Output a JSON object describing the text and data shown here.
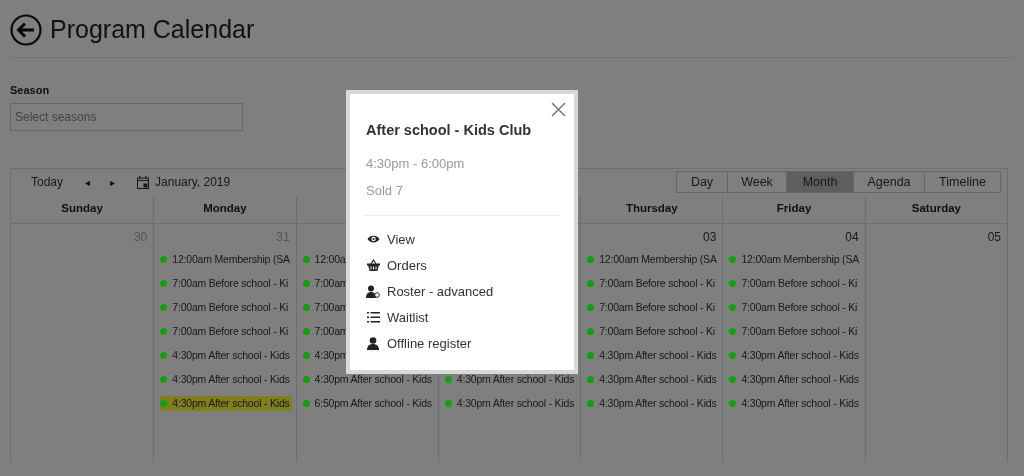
{
  "page": {
    "title": "Program Calendar"
  },
  "season": {
    "label": "Season",
    "placeholder": "Select seasons"
  },
  "toolbar": {
    "today": "Today",
    "prev": "◂",
    "next": "▸",
    "month_label": "January, 2019"
  },
  "views": [
    {
      "label": "Day",
      "selected": false
    },
    {
      "label": "Week",
      "selected": false
    },
    {
      "label": "Month",
      "selected": true
    },
    {
      "label": "Agenda",
      "selected": false
    },
    {
      "label": "Timeline",
      "selected": false
    }
  ],
  "days": [
    {
      "name": "Sunday",
      "date": "30",
      "other_month": true
    },
    {
      "name": "Monday",
      "date": "31",
      "other_month": true,
      "events": [
        {
          "text": "12:00am Membership (SA",
          "color": "#139e13",
          "highlighted": false
        },
        {
          "text": "7:00am Before school - Ki",
          "color": "#139e13",
          "highlighted": false
        },
        {
          "text": "7:00am Before school - Ki",
          "color": "#139e13",
          "highlighted": false
        },
        {
          "text": "7:00am Before school - Ki",
          "color": "#139e13",
          "highlighted": false
        },
        {
          "text": "4:30pm After school - Kids",
          "color": "#139e13",
          "highlighted": false
        },
        {
          "text": "4:30pm After school - Kids",
          "color": "#139e13",
          "highlighted": false
        },
        {
          "text": "4:30pm After school - Kids",
          "color": "#139e13",
          "highlighted": true
        }
      ]
    },
    {
      "events": [
        {
          "text": "12:00a",
          "color": "#139e13",
          "highlighted": false
        },
        {
          "text": "7:00am",
          "color": "#139e13",
          "highlighted": false
        },
        {
          "text": "7:00am",
          "color": "#139e13",
          "highlighted": false
        },
        {
          "text": "7:00am",
          "color": "#139e13",
          "highlighted": false
        },
        {
          "text": "4:30pm",
          "color": "#139e13",
          "highlighted": false
        },
        {
          "text": "4:30pm After school - Kids",
          "color": "#139e13",
          "highlighted": false
        },
        {
          "text": "6:50pm After school - Kids",
          "color": "#139e13",
          "highlighted": false
        }
      ]
    },
    {
      "events": [
        {
          "text": "4:30pm After school - Kids",
          "color": "#139e13",
          "highlighted": false
        },
        {
          "text": "4:30pm After school - Kids",
          "color": "#139e13",
          "highlighted": false
        }
      ]
    },
    {
      "name": "Thursday",
      "date": "03",
      "other_month": false,
      "events": [
        {
          "text": "12:00am Membership (SA",
          "color": "#139e13",
          "highlighted": false
        },
        {
          "text": "7:00am Before school - Ki",
          "color": "#139e13",
          "highlighted": false
        },
        {
          "text": "7:00am Before school - Ki",
          "color": "#139e13",
          "highlighted": false
        },
        {
          "text": "7:00am Before school - Ki",
          "color": "#139e13",
          "highlighted": false
        },
        {
          "text": "4:30pm After school - Kids",
          "color": "#139e13",
          "highlighted": false
        },
        {
          "text": "4:30pm After school - Kids",
          "color": "#139e13",
          "highlighted": false
        },
        {
          "text": "4:30pm After school - Kids",
          "color": "#139e13",
          "highlighted": false
        }
      ]
    },
    {
      "name": "Friday",
      "date": "04",
      "other_month": false,
      "events": [
        {
          "text": "12:00am Membership (SA",
          "color": "#139e13",
          "highlighted": false
        },
        {
          "text": "7:00am Before school - Ki",
          "color": "#139e13",
          "highlighted": false
        },
        {
          "text": "7:00am Before school - Ki",
          "color": "#139e13",
          "highlighted": false
        },
        {
          "text": "7:00am Before school - Ki",
          "color": "#139e13",
          "highlighted": false
        },
        {
          "text": "4:30pm After school - Kids",
          "color": "#139e13",
          "highlighted": false
        },
        {
          "text": "4:30pm After school - Kids",
          "color": "#139e13",
          "highlighted": false
        },
        {
          "text": "4:30pm After school - Kids",
          "color": "#139e13",
          "highlighted": false
        }
      ]
    },
    {
      "name": "Saturday",
      "date": "05",
      "other_month": false
    }
  ],
  "popup": {
    "title": "After school - Kids Club",
    "time": "4:30pm - 6:00pm",
    "sold": "Sold 7",
    "actions": [
      "View",
      "Orders",
      "Roster - advanced",
      "Waitlist",
      "Offline register"
    ]
  }
}
